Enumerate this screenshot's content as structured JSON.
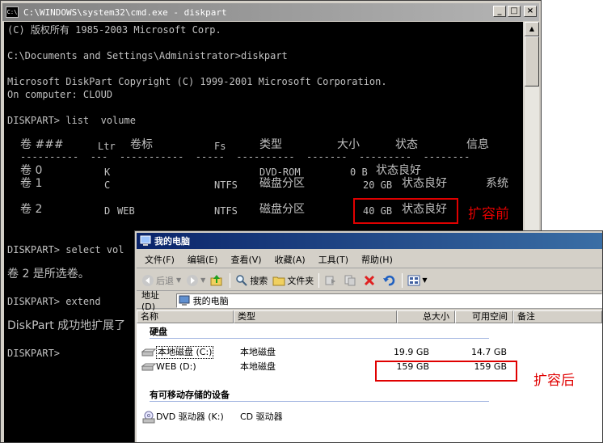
{
  "cmd": {
    "title": "C:\\WINDOWS\\system32\\cmd.exe - diskpart",
    "icon_text": "C:\\",
    "lines": [
      "(C) 版权所有 1985-2003 Microsoft Corp.",
      "C:\\Documents and Settings\\Administrator>diskpart",
      "Microsoft DiskPart Copyright (C) 1999-2001 Microsoft Corporation.",
      "On computer: CLOUD",
      "DISKPART> list  volume",
      "DISKPART> select vol",
      "卷 2 是所选卷。",
      "DISKPART> extend",
      "DiskPart 成功地扩展了",
      "DISKPART>"
    ],
    "volume_table": {
      "headers": [
        "卷 ###",
        "Ltr",
        "卷标",
        "Fs",
        "类型",
        "大小",
        "状态",
        "信息"
      ],
      "rows": [
        {
          "vol": "卷 0",
          "ltr": "K",
          "label": "",
          "fs": "",
          "type": "DVD-ROM",
          "size": "0 B",
          "status": "状态良好",
          "info": ""
        },
        {
          "vol": "卷 1",
          "ltr": "C",
          "label": "",
          "fs": "NTFS",
          "type": "磁盘分区",
          "size": "20 GB",
          "status": "状态良好",
          "info": "系统"
        },
        {
          "vol": "卷 2",
          "ltr": "D",
          "label": "WEB",
          "fs": "NTFS",
          "type": "磁盘分区",
          "size": "40 GB",
          "status": "状态良好",
          "info": ""
        }
      ]
    },
    "annotation_before": "扩容前"
  },
  "explorer": {
    "title": "我的电脑",
    "menu": [
      "文件(F)",
      "编辑(E)",
      "查看(V)",
      "收藏(A)",
      "工具(T)",
      "帮助(H)"
    ],
    "toolbar": {
      "back": "后退",
      "search": "搜索",
      "folders": "文件夹"
    },
    "address_label": "地址(D)",
    "address_value": "我的电脑",
    "columns": [
      "名称",
      "类型",
      "总大小",
      "可用空间",
      "备注"
    ],
    "groups": [
      {
        "label": "硬盘",
        "items": [
          {
            "name": "本地磁盘 (C:)",
            "type": "本地磁盘",
            "total": "19.9 GB",
            "free": "14.7 GB"
          },
          {
            "name": "WEB (D:)",
            "type": "本地磁盘",
            "total": "159 GB",
            "free": "159 GB"
          }
        ]
      },
      {
        "label": "有可移动存储的设备",
        "items": [
          {
            "name": "DVD 驱动器 (K:)",
            "type": "CD 驱动器",
            "total": "",
            "free": ""
          }
        ]
      }
    ],
    "annotation_after": "扩容后"
  },
  "colors": {
    "console_bg": "#000000",
    "console_text": "#c0c0c0",
    "highlight": "#e00000",
    "explorer_title": "#0a246a"
  }
}
